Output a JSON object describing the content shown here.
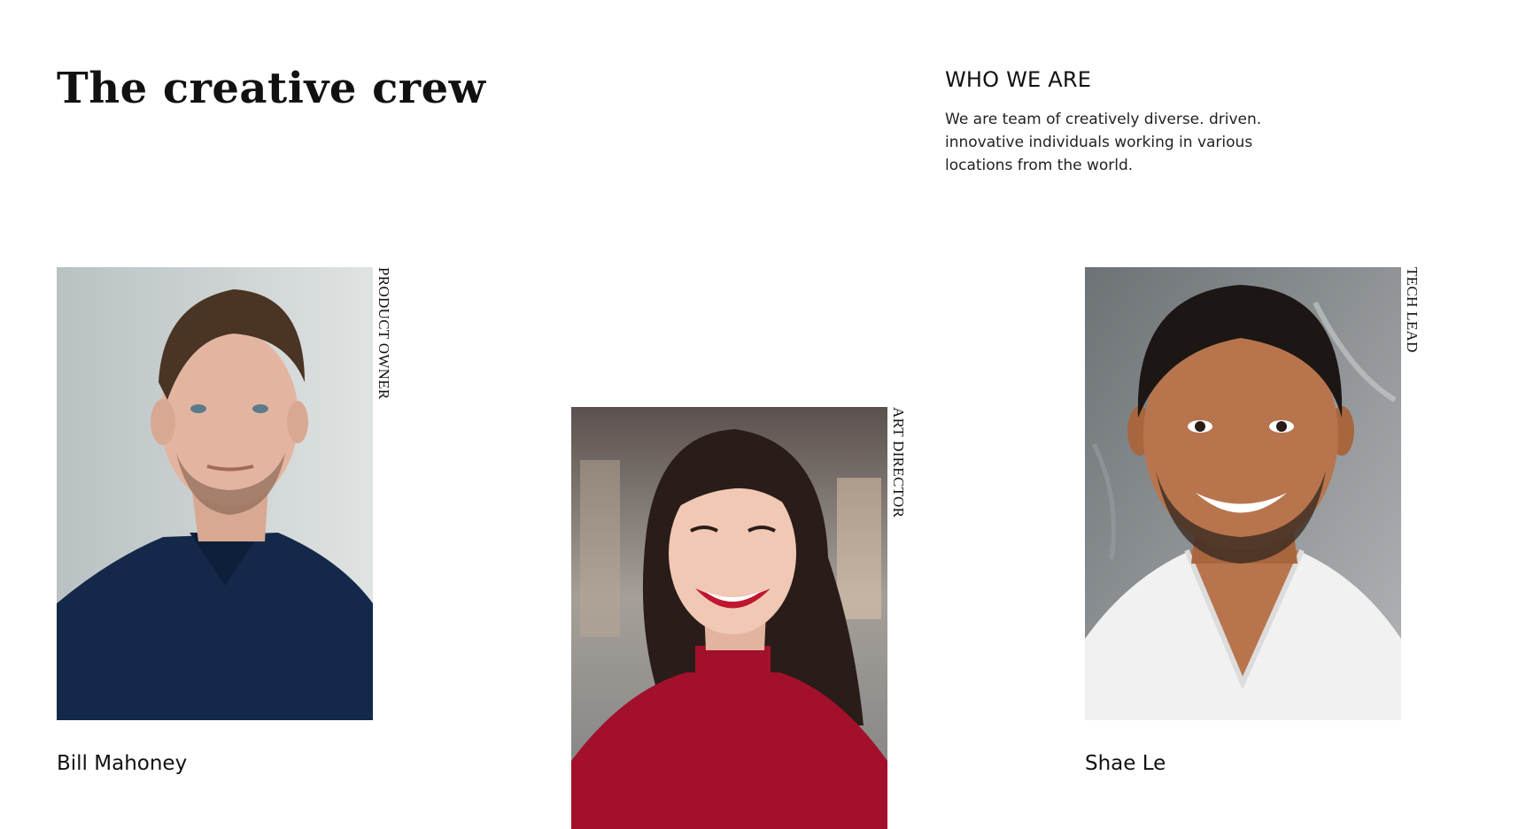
{
  "header": {
    "title": "The creative crew"
  },
  "about": {
    "title": "WHO WE ARE",
    "text": "We are team of creatively diverse. driven. innovative individuals working in various locations from the world."
  },
  "team": [
    {
      "name": "Bill Mahoney",
      "role": "PRODUCT OWNER",
      "photo": "portrait-man-navy-polo",
      "colors": {
        "background": "#c9cfcf",
        "shirt": "#14294a",
        "hair": "#4a3424",
        "skin": "#e3b5a0"
      }
    },
    {
      "name": "",
      "role": "ART DIRECTOR",
      "photo": "portrait-woman-red-top",
      "colors": {
        "background": "#8d8c8a",
        "shirt": "#a3102b",
        "hair": "#2a1c18",
        "skin": "#f0c8b4"
      }
    },
    {
      "name": "Shae Le",
      "role": "TECH LEAD",
      "photo": "portrait-man-white-tshirt",
      "colors": {
        "background": "#8a8f93",
        "shirt": "#f1f1f1",
        "hair": "#1c1714",
        "skin": "#b8754d"
      }
    }
  ]
}
